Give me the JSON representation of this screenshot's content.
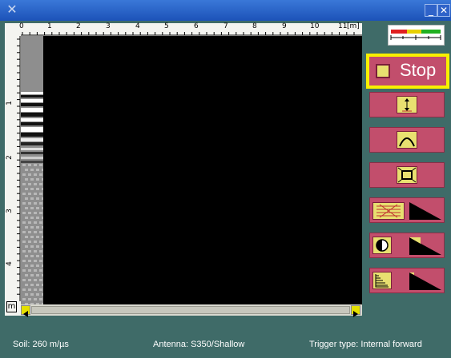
{
  "window": {
    "minimize_label": "_",
    "close_label": "✕",
    "app_icon": "x-logo-icon"
  },
  "ruler": {
    "top_ticks": [
      "0",
      "1",
      "2",
      "3",
      "4",
      "5",
      "6",
      "7",
      "8",
      "9",
      "10",
      "11"
    ],
    "top_unit": "[m]",
    "left_ticks": [
      "1",
      "2",
      "3",
      "4"
    ],
    "left_unit": "m"
  },
  "buttons": {
    "stop_label": "Stop",
    "tools": [
      {
        "name": "depth-cursor",
        "icon": "vertical-arrow-icon"
      },
      {
        "name": "hyperbola-fit",
        "icon": "hyperbola-icon"
      },
      {
        "name": "zoom-fit",
        "icon": "fit-screen-icon"
      },
      {
        "name": "filter-level",
        "icon": "filter-icon"
      },
      {
        "name": "contrast-level",
        "icon": "contrast-icon"
      },
      {
        "name": "gain-level",
        "icon": "gain-staircase-icon"
      }
    ]
  },
  "status": {
    "soil": "Soil:  260 m/µs",
    "antenna": "Antenna: S350/Shallow",
    "trigger": "Trigger type: Internal forward"
  },
  "colors": {
    "background": "#3f6b68",
    "button": "#c24e6c",
    "highlight": "#f8f000",
    "icon_fill": "#e8e070"
  }
}
